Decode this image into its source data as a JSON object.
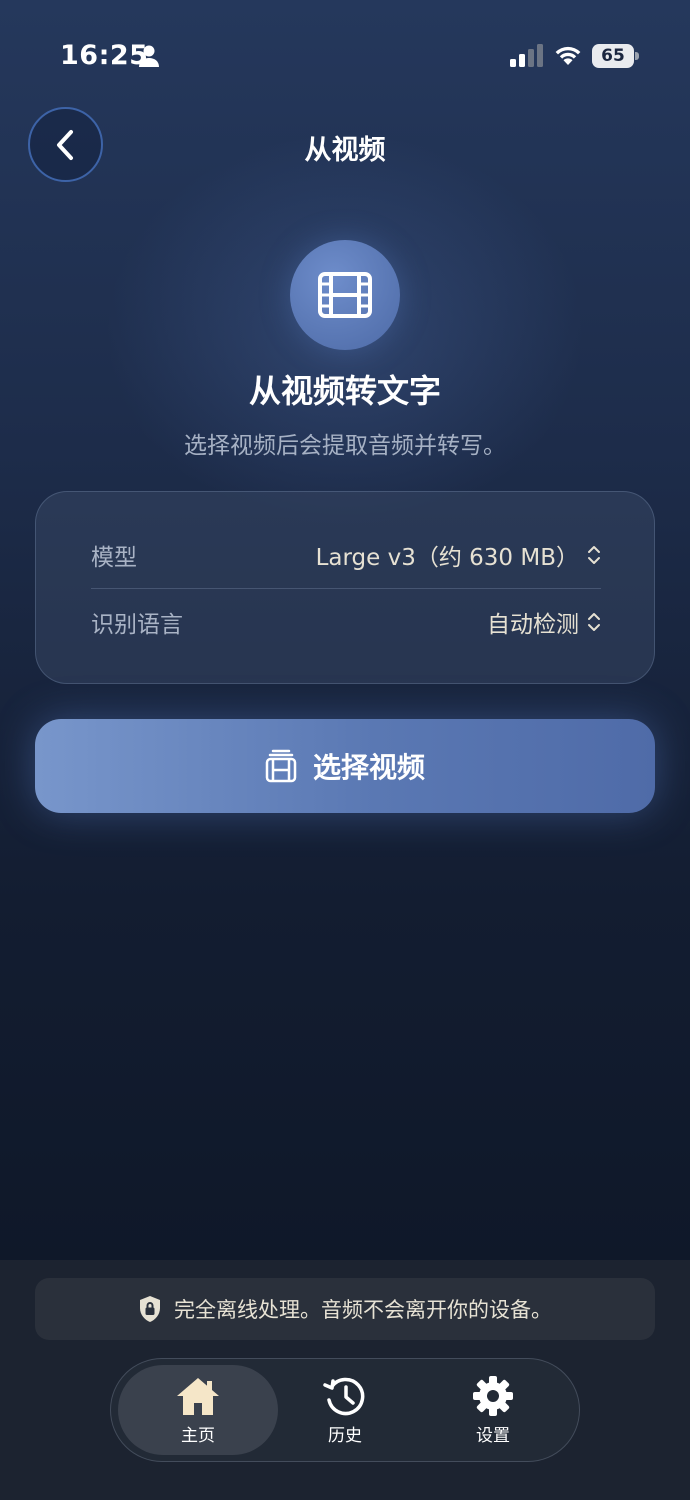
{
  "status_bar": {
    "time": "16:25",
    "battery": "65",
    "icons": [
      "person-icon",
      "signal-icon",
      "wifi-icon",
      "battery-icon"
    ]
  },
  "header": {
    "title": "从视频",
    "back_icon": "chevron-left-icon"
  },
  "hero": {
    "icon": "film-icon",
    "title": "从视频转文字",
    "subtitle": "选择视频后会提取音频并转写。"
  },
  "settings": {
    "model_label": "模型",
    "model_value": "Large v3（约 630 MB）",
    "language_label": "识别语言",
    "language_value": "自动检测"
  },
  "actions": {
    "select_video_label": "选择视频",
    "select_video_icon": "film-stack-icon"
  },
  "banner": {
    "icon": "shield-lock-icon",
    "text": "完全离线处理。音频不会离开你的设备。"
  },
  "tabs": [
    {
      "label": "主页",
      "icon": "home-icon",
      "selected": true
    },
    {
      "label": "历史",
      "icon": "history-icon",
      "selected": false
    },
    {
      "label": "设置",
      "icon": "gear-icon",
      "selected": false
    }
  ],
  "colors": {
    "accent": "#5a78b3",
    "accent_light": "#7896cb",
    "value_text": "#e6e1d3",
    "muted_text": "#a9b3c5",
    "bottom_panel": "#1c2330"
  }
}
